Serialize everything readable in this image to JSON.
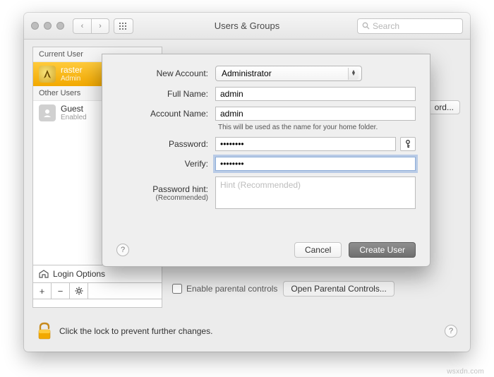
{
  "window": {
    "title": "Users & Groups",
    "search_placeholder": "Search"
  },
  "sidebar": {
    "current_label": "Current User",
    "other_label": "Other Users",
    "current_user": {
      "name": "raster",
      "role": "Admin"
    },
    "other_user": {
      "name": "Guest",
      "sub": "Enabled"
    },
    "login_options": "Login Options",
    "add_symbol": "+",
    "remove_symbol": "−",
    "gear_symbol": "✻"
  },
  "main": {
    "change_password": "ord...",
    "enable_parental": "Enable parental controls",
    "open_parental": "Open Parental Controls..."
  },
  "lock": {
    "text": "Click the lock to prevent further changes."
  },
  "sheet": {
    "labels": {
      "new_account": "New Account:",
      "full_name": "Full Name:",
      "account_name": "Account Name:",
      "password": "Password:",
      "verify": "Verify:",
      "password_hint": "Password hint:",
      "recommended": "(Recommended)"
    },
    "values": {
      "account_type": "Administrator",
      "full_name": "admin",
      "account_name": "admin",
      "password": "••••••••",
      "verify": "••••••••"
    },
    "helper": "This will be used as the name for your home folder.",
    "hint_placeholder": "Hint (Recommended)",
    "buttons": {
      "cancel": "Cancel",
      "create": "Create User"
    }
  },
  "watermark": "wsxdn.com"
}
